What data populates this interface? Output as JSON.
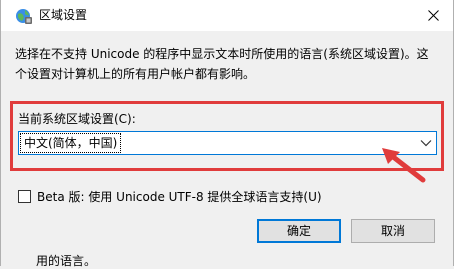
{
  "window": {
    "title": "区域设置",
    "icon": "globe-settings-icon",
    "close_icon": "close-icon"
  },
  "description": {
    "line1": "选择在不支持 Unicode 的程序中显示文本时所使用的语言(系统区域设置)。这",
    "line2": "个设置对计算机上的所有用户帐户都有影响。"
  },
  "locale": {
    "label": "当前系统区域设置(C):",
    "value": "中文(简体，中国)"
  },
  "beta": {
    "label": "Beta 版: 使用 Unicode UTF-8 提供全球语言支持(U)",
    "checked": false
  },
  "buttons": {
    "ok": "确定",
    "cancel": "取消"
  },
  "background_fragment": "用的语言。",
  "colors": {
    "highlight_box": "#e03c3c",
    "focus_border": "#0078d7"
  }
}
